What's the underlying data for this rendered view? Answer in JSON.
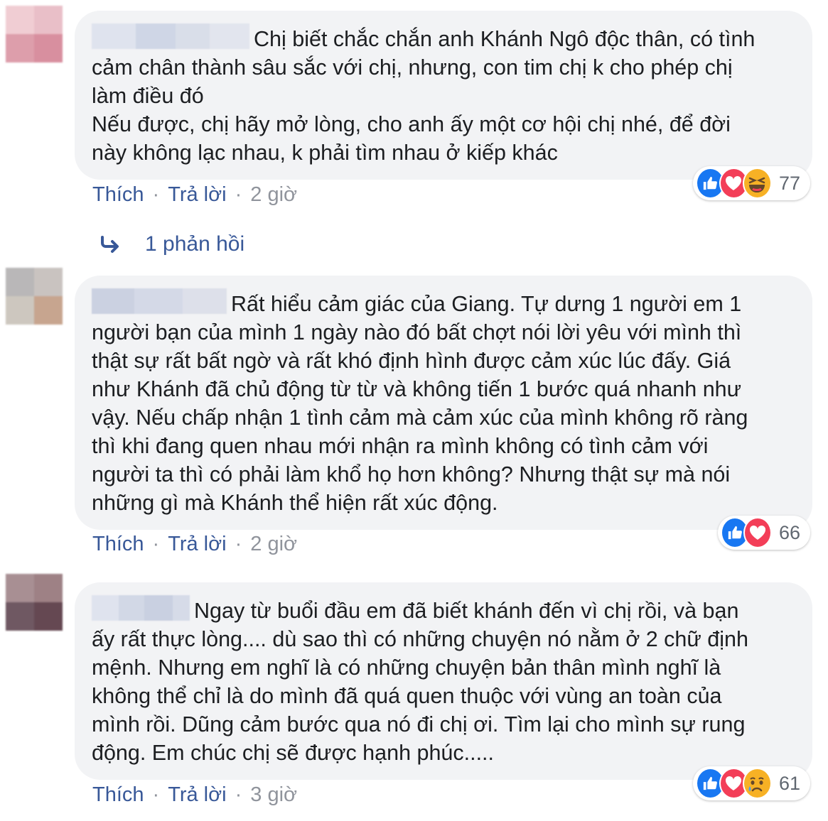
{
  "comments": [
    {
      "text": "Chị biết chắc chắn anh Khánh Ngô độc thân, có tình\ncảm chân thành sâu sắc với chị, nhưng, con tim chị k cho phép chị\nlàm điều đó\nNếu được, chị hãy mở lòng, cho anh ấy một cơ hội chị nhé, để đời\nnày không lạc nhau, k phải tìm nhau ở kiếp khác",
      "reaction_icons": [
        "like-icon",
        "love-icon",
        "haha-icon"
      ],
      "reaction_count": "77",
      "like_label": "Thích",
      "reply_label": "Trả lời",
      "time": "2 giờ"
    },
    {
      "text": "Rất hiểu cảm giác của Giang. Tự dưng 1 người em 1\nngười bạn của mình 1 ngày nào đó bất chợt nói lời yêu với mình thì\nthật sự rất bất ngờ và rất khó định hình được cảm xúc lúc đấy. Giá\nnhư Khánh đã chủ động từ từ và không tiến 1 bước quá nhanh như\nvậy. Nếu chấp nhận 1 tình cảm mà cảm xúc của mình không rõ ràng\nthì khi đang quen nhau mới nhận ra mình không có tình cảm với\nngười ta thì có phải làm khổ họ hơn không? Nhưng thật sự mà nói\nnhững gì mà Khánh thể hiện rất xúc động.",
      "reaction_icons": [
        "like-icon",
        "love-icon"
      ],
      "reaction_count": "66",
      "like_label": "Thích",
      "reply_label": "Trả lời",
      "time": "2 giờ"
    },
    {
      "text": "Ngay từ buổi đầu em đã biết khánh đến vì chị rồi, và bạn\nấy rất thực lòng.... dù sao thì có những chuyện nó nằm ở 2 chữ định\nmệnh. Nhưng em nghĩ là có những chuyện bản thân mình nghĩ là\nkhông thể chỉ là do mình đã quá quen thuộc với vùng an toàn của\nmình rồi. Dũng cảm bước qua nó đi chị ơi. Tìm lại cho mình sự rung\nđộng. Em chúc chị sẽ được hạnh phúc.....",
      "reaction_icons": [
        "like-icon",
        "love-icon",
        "sad-icon"
      ],
      "reaction_count": "61",
      "like_label": "Thích",
      "reply_label": "Trả lời",
      "time": "3 giờ"
    }
  ],
  "replies_link": "1 phản hồi",
  "colors": {
    "bubble": "#f2f3f5",
    "link": "#385898",
    "meta": "#90949c",
    "text": "#1c1e21"
  }
}
